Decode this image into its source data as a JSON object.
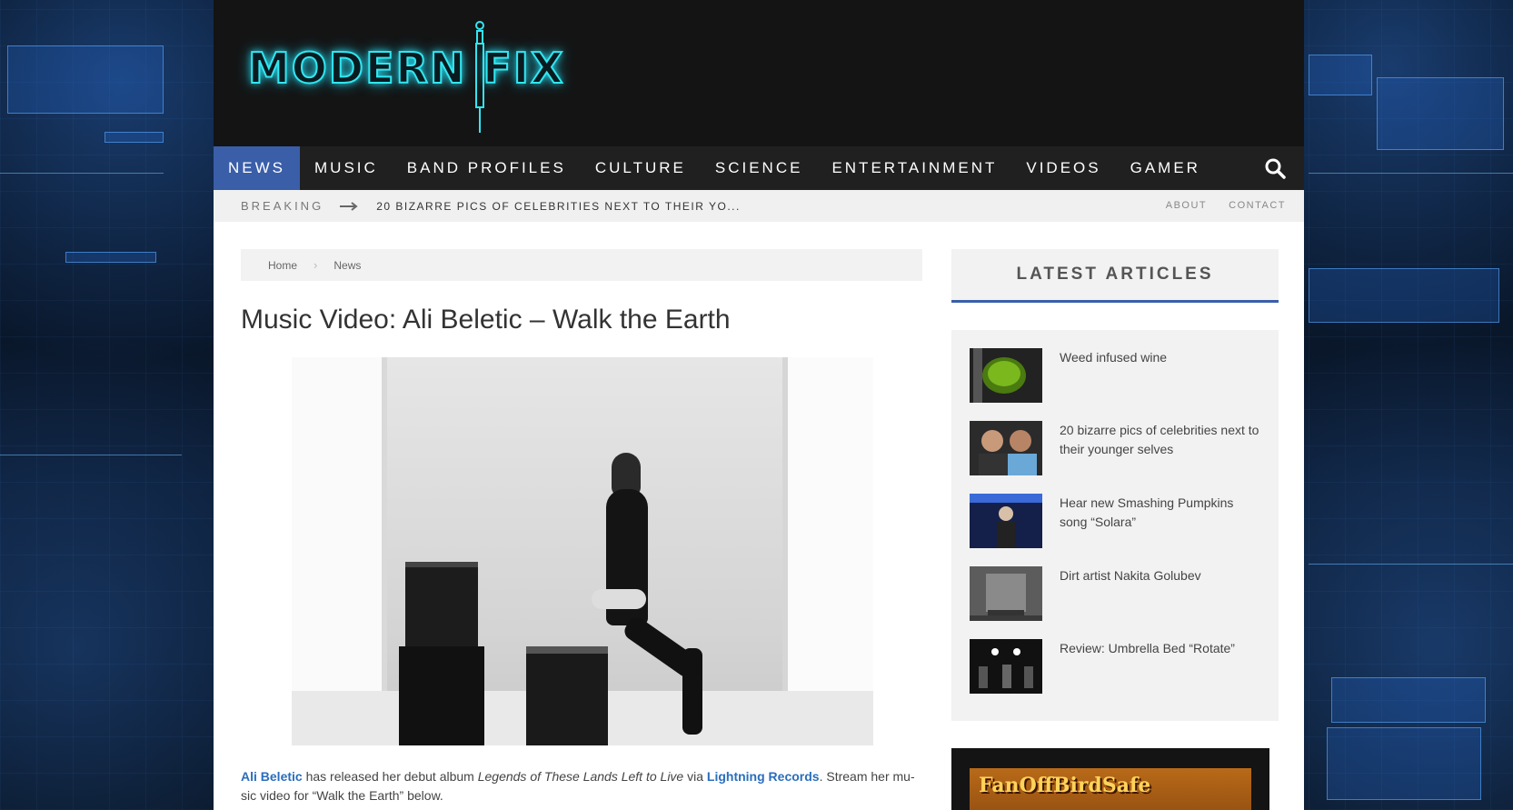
{
  "site": {
    "logo_text": "MODERN FIX"
  },
  "nav": {
    "items": [
      "NEWS",
      "MUSIC",
      "BAND PROFILES",
      "CULTURE",
      "SCIENCE",
      "ENTERTAINMENT",
      "VIDEOS",
      "GAMER"
    ],
    "active": "NEWS"
  },
  "breaking": {
    "label": "BREAKING",
    "text": "20 BIZARRE PICS OF CELEBRITIES NEXT TO THEIR YO..."
  },
  "top_links": {
    "about": "ABOUT",
    "contact": "CONTACT"
  },
  "breadcrumb": {
    "home": "Home",
    "current": "News"
  },
  "post": {
    "title": "Music Video: Ali Beletic – Walk the Earth",
    "artist_link": "Ali Beletic",
    "text_1": " has released her debut album ",
    "album": "Legends of These Lands Left to Live",
    "text_2": " via ",
    "label_link": "Lightning Records",
    "text_3": ". Stream her mu-sic video for “Walk the Earth” below."
  },
  "sidebar": {
    "widget_title": "LATEST ARTICLES",
    "articles": [
      {
        "title": "Weed infused wine"
      },
      {
        "title": "20 bizarre pics of celebrities next to their younger selves"
      },
      {
        "title": "Hear new Smashing Pumpkins song “Solara”"
      },
      {
        "title": "Dirt artist Nakita Golubev"
      },
      {
        "title": "Review: Umbrella Bed “Rotate”"
      }
    ],
    "ad_text": "FanOffBirdSafe"
  },
  "colors": {
    "accent": "#3a5ea8",
    "link": "#2a6ebd",
    "logo_glow": "#31e6f0"
  }
}
